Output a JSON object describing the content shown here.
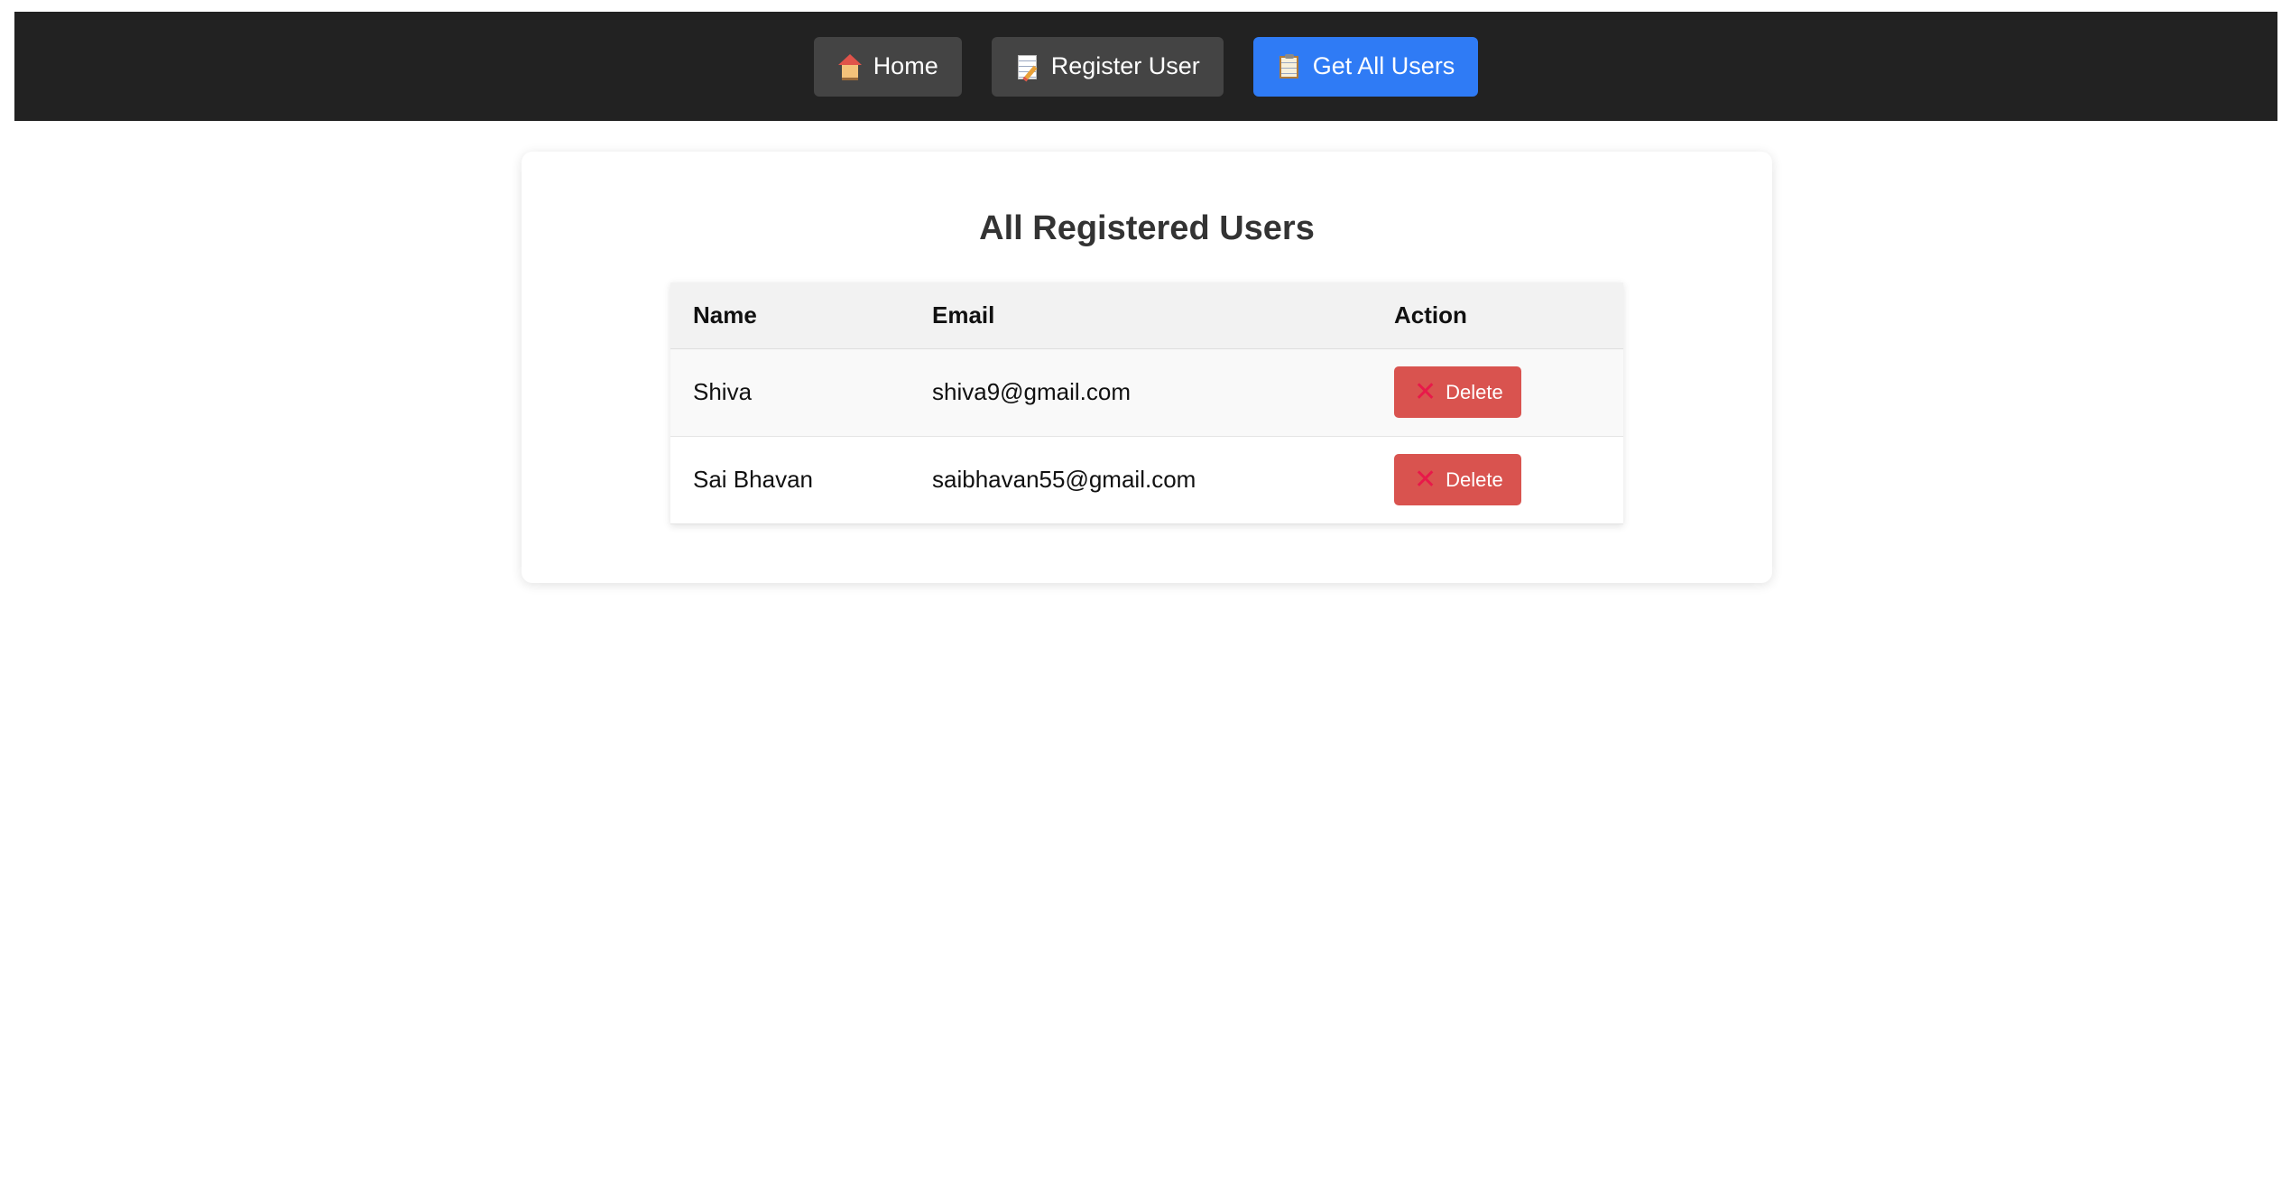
{
  "nav": {
    "items": [
      {
        "label": "Home",
        "icon": "house-icon",
        "active": false
      },
      {
        "label": "Register User",
        "icon": "memo-icon",
        "active": false
      },
      {
        "label": "Get All Users",
        "icon": "clipboard-icon",
        "active": true
      }
    ],
    "colors": {
      "background": "#222222",
      "button": "#444444",
      "active": "#2f7bf5"
    }
  },
  "main": {
    "title": "All Registered Users",
    "table": {
      "headers": [
        "Name",
        "Email",
        "Action"
      ],
      "rows": [
        {
          "name": "Shiva",
          "email": "shiva9@gmail.com",
          "action_label": "Delete",
          "action_icon": "x-icon"
        },
        {
          "name": "Sai Bhavan",
          "email": "saibhavan55@gmail.com",
          "action_label": "Delete",
          "action_icon": "x-icon"
        }
      ]
    },
    "colors": {
      "delete_button": "#d9534f",
      "x_icon": "#e8194a"
    }
  }
}
